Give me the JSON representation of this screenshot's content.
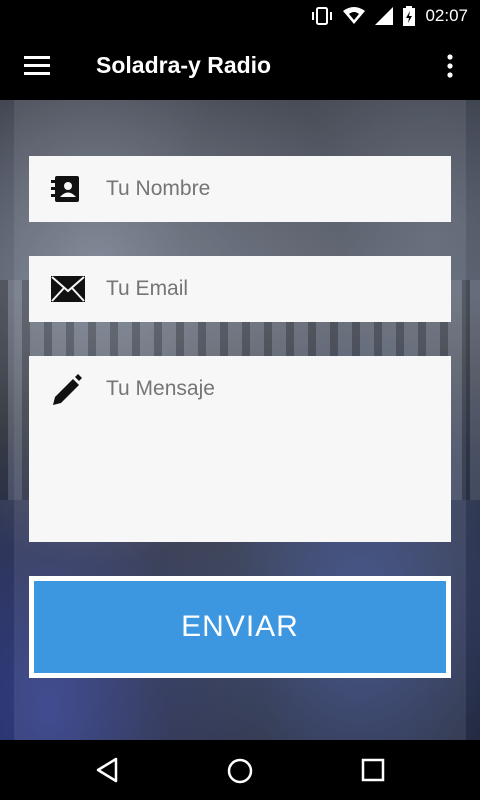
{
  "status_bar": {
    "time": "02:07"
  },
  "toolbar": {
    "title": "Soladra-y Radio"
  },
  "form": {
    "name_placeholder": "Tu Nombre",
    "email_placeholder": "Tu Email",
    "message_placeholder": "Tu Mensaje",
    "send_label": "ENVIAR"
  },
  "colors": {
    "accent": "#3d96e0",
    "toolbar": "#000000",
    "field_bg": "#f7f7f7"
  },
  "icons": {
    "menu": "hamburger-icon",
    "more": "more-vert-icon",
    "name": "contact-card-icon",
    "email": "envelope-icon",
    "message": "pencil-icon"
  }
}
